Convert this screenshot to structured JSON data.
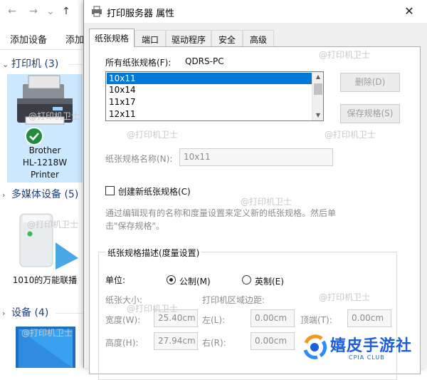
{
  "explorer": {
    "nav": {
      "back": "←",
      "forward": "→",
      "dropdown": "⌄",
      "up": "↑"
    },
    "commands": [
      "添加设备",
      "添加"
    ],
    "groups": [
      {
        "label": "打印机 (3)"
      },
      {
        "label": "多媒体设备 (5)"
      },
      {
        "label": "设备 (4)"
      }
    ],
    "printer_tile": {
      "lines": [
        "Brother",
        "HL-1218W",
        "Printer"
      ]
    },
    "media_tile": {
      "label": "1010的万能联播"
    }
  },
  "watermark": "@打印机卫士",
  "dialog": {
    "title": "打印服务器 属性",
    "close": "✕",
    "tabs": [
      "纸张规格",
      "端口",
      "驱动程序",
      "安全",
      "高级"
    ],
    "forms_label": "所有纸张规格(F):",
    "server_name": "QDRS-PC",
    "forms": [
      "10x11",
      "10x14",
      "11x17",
      "12x11"
    ],
    "selected_form": "10x11",
    "delete_button": "删除(D)",
    "save_button": "保存规格(S)",
    "form_name_label": "纸张规格名称(N):",
    "form_name_value": "10x11",
    "create_checkbox": "创建新纸张规格(C)",
    "help_lines": [
      "通过编辑现有的名称和度量设置来定义新的纸张规格。然后单",
      "击\"保存规格\"。"
    ],
    "group_title": "纸张规格描述(度量设置)",
    "units_label": "单位:",
    "unit_metric": "公制(M)",
    "unit_english": "英制(E)",
    "units_selected": "metric",
    "paper_size_label": "纸张大小:",
    "margins_label": "打印机区域边距:",
    "width_label": "宽度(W):",
    "width_value": "25.40cm",
    "height_label": "高度(H):",
    "height_value": "27.94cm",
    "left_label": "左(L):",
    "left_value": "0.00cm",
    "right_label": "右(R):",
    "right_value": "0.00cm",
    "top_label": "顶端(T):",
    "top_value": "0.00cm"
  },
  "brand": {
    "name": "嬉皮手游社",
    "sub": "CPIA CLUB"
  },
  "colors": {
    "selection": "#0078d7",
    "tile_highlight": "#cce8ff",
    "brand": "#1e5fd8"
  }
}
